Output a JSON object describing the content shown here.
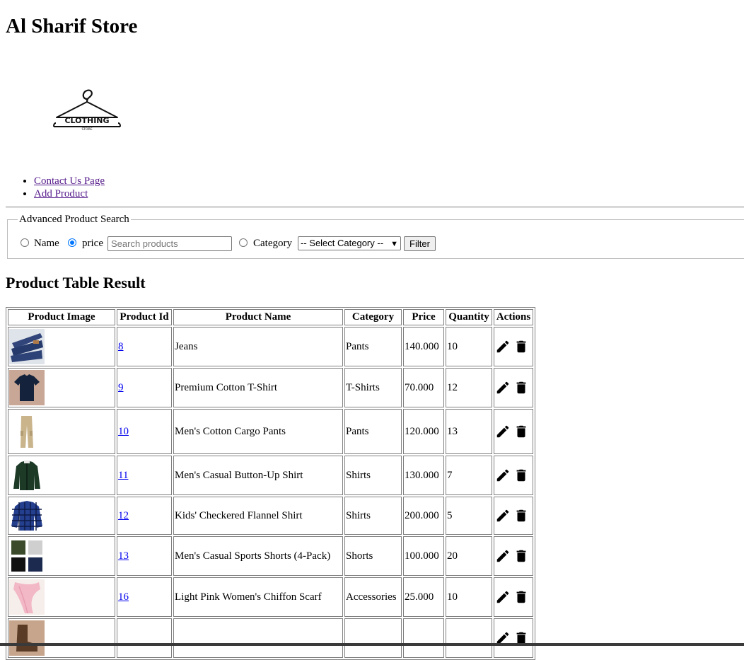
{
  "page": {
    "title": "Al Sharif Store"
  },
  "logo": {
    "line1": "CLOTHING",
    "line2": "STORE"
  },
  "nav": [
    {
      "label": "Contact Us Page"
    },
    {
      "label": "Add Product"
    }
  ],
  "search": {
    "legend": "Advanced Product Search",
    "radio_name": "Name",
    "radio_price": "price",
    "selected": "price",
    "placeholder": "Search products",
    "radio_category": "Category",
    "category_selected": "-- Select Category --",
    "filter_label": "Filter"
  },
  "results": {
    "heading": "Product Table Result",
    "columns": [
      "Product Image",
      "Product Id",
      "Product Name",
      "Category",
      "Price",
      "Quantity",
      "Actions"
    ],
    "rows": [
      {
        "id": "8",
        "name": "Jeans",
        "category": "Pants",
        "price": "140.000",
        "quantity": "10",
        "image": "jeans-image"
      },
      {
        "id": "9",
        "name": "Premium Cotton T-Shirt",
        "category": "T-Shirts",
        "price": "70.000",
        "quantity": "12",
        "image": "tshirt-image"
      },
      {
        "id": "10",
        "name": "Men's Cotton Cargo Pants",
        "category": "Pants",
        "price": "120.000",
        "quantity": "13",
        "image": "cargo-pants-image"
      },
      {
        "id": "11",
        "name": "Men's Casual Button-Up Shirt",
        "category": "Shirts",
        "price": "130.000",
        "quantity": "7",
        "image": "button-shirt-image"
      },
      {
        "id": "12",
        "name": "Kids' Checkered Flannel Shirt",
        "category": "Shirts",
        "price": "200.000",
        "quantity": "5",
        "image": "flannel-shirt-image"
      },
      {
        "id": "13",
        "name": "Men's Casual Sports Shorts (4-Pack)",
        "category": "Shorts",
        "price": "100.000",
        "quantity": "20",
        "image": "shorts-image"
      },
      {
        "id": "16",
        "name": "Light Pink Women's Chiffon Scarf",
        "category": "Accessories",
        "price": "25.000",
        "quantity": "10",
        "image": "scarf-image"
      },
      {
        "id": "",
        "name": "",
        "category": "",
        "price": "",
        "quantity": "",
        "image": "boots-image"
      }
    ]
  },
  "icons": {
    "edit": "pencil-icon",
    "delete": "trash-icon"
  }
}
